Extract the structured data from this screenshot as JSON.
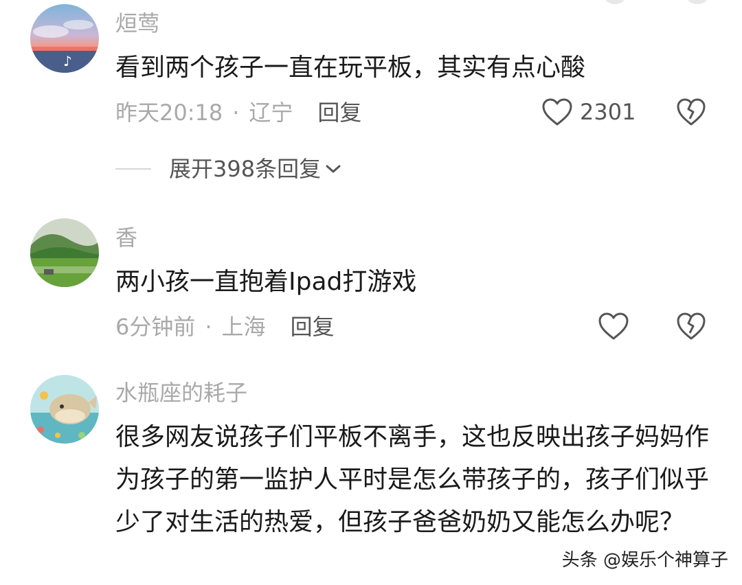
{
  "comments": [
    {
      "username": "烜莺",
      "text": "看到两个孩子一直在玩平板，其实有点心酸",
      "time": "昨天20:18",
      "separator": "·",
      "location": "辽宁",
      "reply_label": "回复",
      "like_count": "2301",
      "expand_label": "展开398条回复",
      "avatar_icon": "sunset-sea-tiktok-avatar"
    },
    {
      "username": "香",
      "text": "两小孩一直抱着Ipad打游戏",
      "time": "6分钟前",
      "separator": "·",
      "location": "上海",
      "reply_label": "回复",
      "avatar_icon": "green-hills-avatar"
    },
    {
      "username": "水瓶座的耗子",
      "text": "很多网友说孩子们平板不离手，这也反映出孩子妈妈作为孩子的第一监护人平时是怎么带孩子的，孩子们似乎少了对生活的热爱，但孩子爸爸奶奶又能怎么办呢？",
      "avatar_icon": "cartoon-whale-avatar"
    }
  ],
  "watermark": "头条 @娱乐个神算子",
  "colors": {
    "meta_gray": "#a9a9a9",
    "text_dark": "#1a1a1a",
    "action_gray": "#555555"
  }
}
